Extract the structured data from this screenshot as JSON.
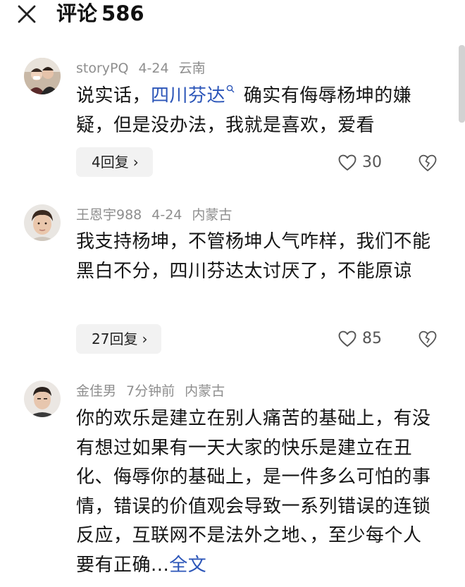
{
  "header": {
    "title": "评论",
    "count": "586"
  },
  "comments": [
    {
      "user": "storyPQ",
      "date": "4-24",
      "location": "云南",
      "text_before": "说实话，",
      "mention": "四川芬达",
      "text_after": " 确实有侮辱杨坤的嫌疑，但是没办法，我就是喜欢，爱看",
      "replies": "4回复",
      "likes": "30"
    },
    {
      "user": "王恩宇988",
      "date": "4-24",
      "location": "内蒙古",
      "text": "我支持杨坤，不管杨坤人气咋样，我们不能黑白不分，四川芬达太讨厌了，不能原谅",
      "replies": "27回复",
      "likes": "85"
    },
    {
      "user": "金佳男",
      "date": "7分钟前",
      "location": "内蒙古",
      "text": "你的欢乐是建立在别人痛苦的基础上，有没有想过如果有一天大家的快乐是建立在丑化、侮辱你的基础上，是一件多么可怕的事情，错误的价值观会导致一系列错误的连锁反应，互联网不是法外之地、，至少每个人要有正确...",
      "more": "全文"
    }
  ],
  "icons": {
    "close": "close-icon",
    "like": "heart-outline-icon",
    "dislike": "broken-heart-icon",
    "mention": "search-icon",
    "chevron": "chevron-right-icon"
  },
  "colors": {
    "link": "#2b55b8",
    "meta": "#8e8e8e",
    "reply_bg": "#f2f2f2"
  }
}
